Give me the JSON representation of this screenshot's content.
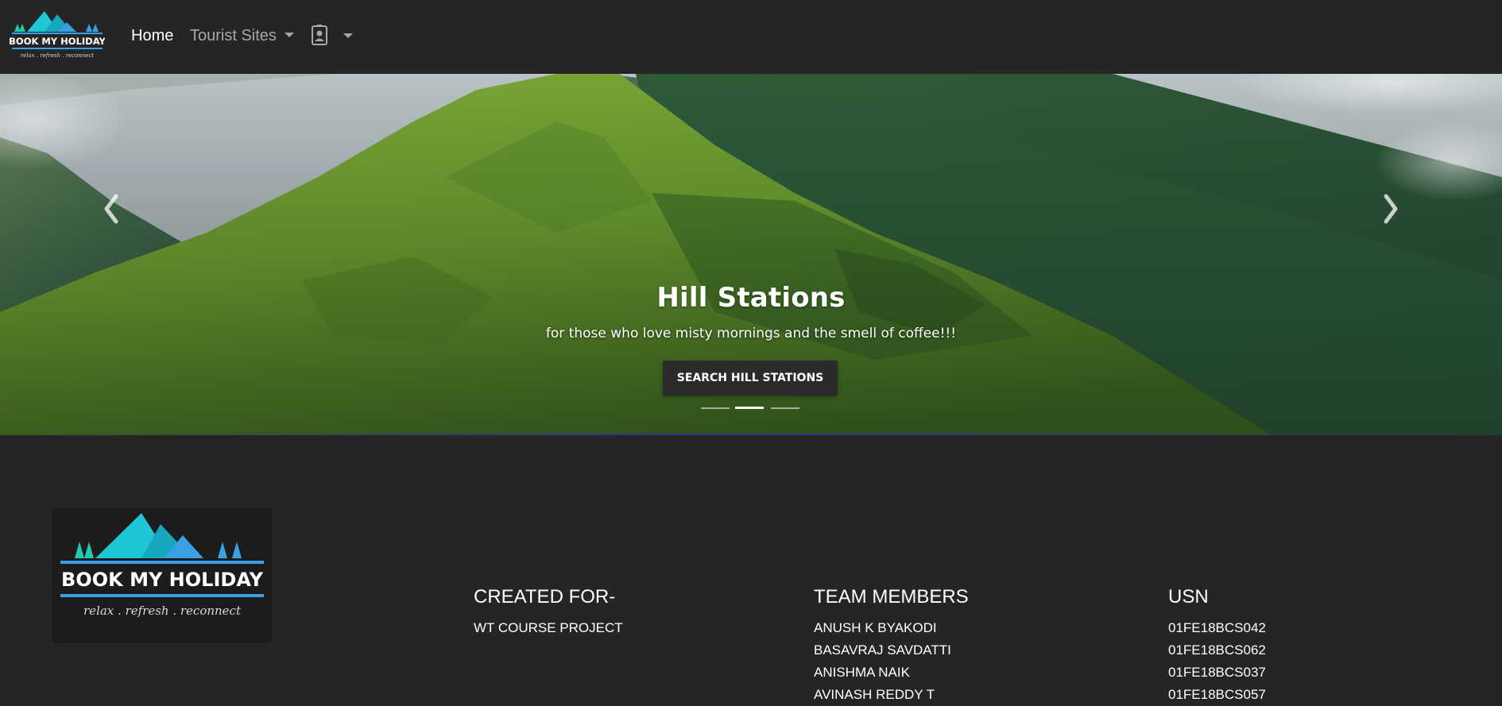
{
  "brand": {
    "name": "BOOK MY HOLIDAY",
    "tagline": "relax . refresh . reconnect",
    "colors": {
      "mountain": "#1ec7d8",
      "tree": "#20c9b0",
      "bar": "#3aa0e6"
    }
  },
  "nav": {
    "home_label": "Home",
    "tourist_sites_label": "Tourist Sites",
    "profile_icon": "person-badge-icon"
  },
  "carousel": {
    "title": "Hill Stations",
    "subtitle": "for those who love misty mornings and the smell of coffee!!!",
    "button_label": "SEARCH HILL STATIONS",
    "slide_count": 3,
    "active_slide": 2,
    "prev_icon": "chevron-left-icon",
    "next_icon": "chevron-right-icon"
  },
  "footer": {
    "created_for": {
      "heading": "CREATED FOR-",
      "text": "WT COURSE PROJECT"
    },
    "team": {
      "heading": "TEAM MEMBERS",
      "members": [
        "ANUSH K BYAKODI",
        "BASAVRAJ SAVDATTI",
        "ANISHMA NAIK",
        "AVINASH REDDY T"
      ]
    },
    "usn": {
      "heading": "USN",
      "values": [
        "01FE18BCS042",
        "01FE18BCS062",
        "01FE18BCS037",
        "01FE18BCS057"
      ]
    }
  }
}
